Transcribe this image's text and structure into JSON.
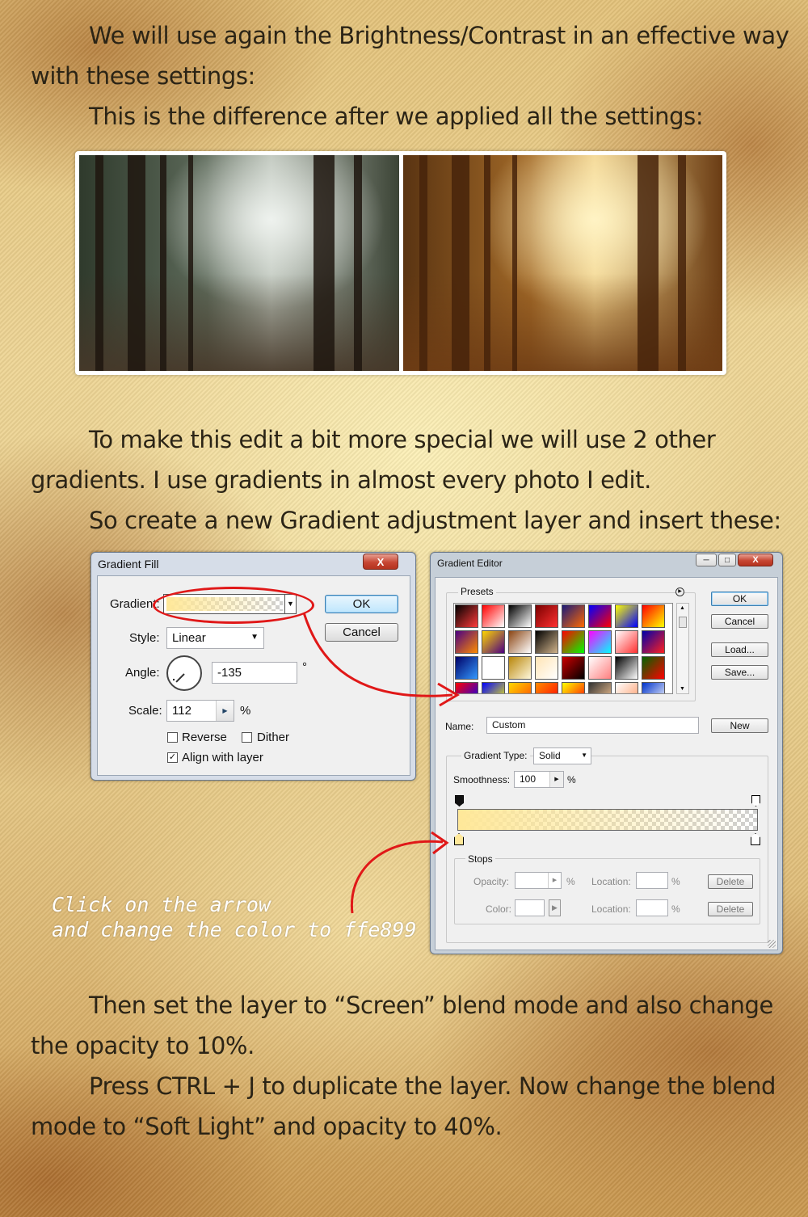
{
  "paragraphs": {
    "p1": "We will use again the Brightness/Contrast in an effective way with these settings:",
    "p2": "This is the difference after we applied all the settings:",
    "p3": "To make this edit a bit more special we will use 2 other gradients. I use gradients in almost every photo I edit.",
    "p4": "So create a new Gradient adjustment layer and insert these:",
    "p5": "Then set the layer to “Screen” blend mode and also change the opacity to 10%.",
    "p6": "Press CTRL + J to duplicate the layer. Now change the blend mode to “Soft Light” and opacity to 40%."
  },
  "gradient_fill": {
    "title": "Gradient Fill",
    "close": "X",
    "gradient_label": "Gradient:",
    "style_label": "Style:",
    "style_value": "Linear",
    "angle_label": "Angle:",
    "angle_value": "-135",
    "angle_unit": "°",
    "scale_label": "Scale:",
    "scale_value": "112",
    "scale_unit": "%",
    "reverse": "Reverse",
    "dither": "Dither",
    "align": "Align with layer",
    "ok": "OK",
    "cancel": "Cancel",
    "gradient_color": "#ffe899"
  },
  "gradient_editor": {
    "title": "Gradient Editor",
    "presets_label": "Presets",
    "ok": "OK",
    "cancel": "Cancel",
    "load": "Load...",
    "save": "Save...",
    "name_label": "Name:",
    "name_value": "Custom",
    "new": "New",
    "type_label": "Gradient Type:",
    "type_value": "Solid",
    "smoothness_label": "Smoothness:",
    "smoothness_value": "100",
    "smoothness_unit": "%",
    "stops_label": "Stops",
    "opacity_label": "Opacity:",
    "color_label": "Color:",
    "location_label": "Location:",
    "pct": "%",
    "delete": "Delete",
    "preset_colors": [
      [
        "#000000",
        "#ff3b3b"
      ],
      [
        "#ff0000",
        "#ffffff"
      ],
      [
        "#000000",
        "#ffffff"
      ],
      [
        "#7a0000",
        "#ff3030"
      ],
      [
        "#1a1a7a",
        "#ff6a00"
      ],
      [
        "#0000ff",
        "#ff0000"
      ],
      [
        "#ffff00",
        "#0000ff"
      ],
      [
        "#ff0000",
        "#ffff00"
      ],
      [
        "#4b0082",
        "#ff8c00"
      ],
      [
        "#ffd700",
        "#4b0082"
      ],
      [
        "#8b4513",
        "#ffffff"
      ],
      [
        "#000000",
        "#d2b48c"
      ],
      [
        "#ff0000",
        "#00ff00"
      ],
      [
        "#ff00ff",
        "#00ffff"
      ],
      [
        "#ffffff",
        "#ff3030"
      ],
      [
        "#0000aa",
        "#ff2020"
      ],
      [
        "#000066",
        "#3399ff"
      ],
      [
        "#ffffff",
        "#ffffff"
      ],
      [
        "#b8860b",
        "#fff8dc"
      ],
      [
        "#ffe4b5",
        "#ffffff"
      ],
      [
        "#cc0000",
        "#000000"
      ],
      [
        "#ffffff",
        "#ff8080"
      ],
      [
        "#000000",
        "#ffffff"
      ],
      [
        "#006400",
        "#ff0000"
      ],
      [
        "#ff0000",
        "#0000ff"
      ],
      [
        "#0000ff",
        "#ffff00"
      ],
      [
        "#ffd700",
        "#ff4500"
      ],
      [
        "#ff8c00",
        "#ff0000"
      ],
      [
        "#ffff00",
        "#ff0000"
      ],
      [
        "#333333",
        "#ffcc99"
      ],
      [
        "#ffffff",
        "#ff9966"
      ],
      [
        "#0033cc",
        "#ffffff"
      ]
    ]
  },
  "note": {
    "line1": "Click on the arrow",
    "line2": "and change the color to ffe899"
  }
}
